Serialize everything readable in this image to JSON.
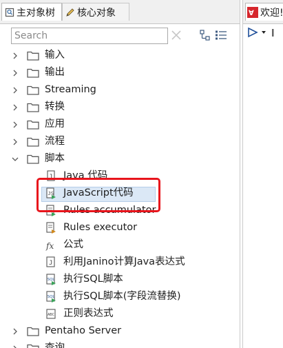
{
  "left_tabs": {
    "main_tree": "主对象树",
    "core_objects": "核心对象"
  },
  "search": {
    "placeholder": "Search",
    "value": ""
  },
  "tree": {
    "categories": [
      {
        "label": "输入",
        "expanded": false
      },
      {
        "label": "输出",
        "expanded": false
      },
      {
        "label": "Streaming",
        "expanded": false
      },
      {
        "label": "转换",
        "expanded": false
      },
      {
        "label": "应用",
        "expanded": false
      },
      {
        "label": "流程",
        "expanded": false
      },
      {
        "label": "脚本",
        "expanded": true
      }
    ],
    "script_steps": [
      {
        "label": "Java 代码",
        "icon": "java-code-icon"
      },
      {
        "label": "JavaScript代码",
        "icon": "javascript-code-icon",
        "selected": true
      },
      {
        "label": "Rules accumulator",
        "icon": "rules-accumulator-icon"
      },
      {
        "label": "Rules executor",
        "icon": "rules-executor-icon"
      },
      {
        "label": "公式",
        "icon": "formula-icon"
      },
      {
        "label": "利用Janino计算Java表达式",
        "icon": "janino-icon"
      },
      {
        "label": "执行SQL脚本",
        "icon": "sql-script-icon"
      },
      {
        "label": "执行SQL脚本(字段流替换)",
        "icon": "sql-script-stream-icon"
      },
      {
        "label": "正则表达式",
        "icon": "regex-icon"
      }
    ],
    "after": [
      {
        "label": "Pentaho Server",
        "expanded": false
      },
      {
        "label": "查询",
        "expanded": false
      }
    ]
  },
  "right_tabs": {
    "welcome": "欢迎!"
  },
  "colors": {
    "highlight": "#e8141c",
    "selection": "#dbe8f6",
    "folder": "#5a5a5a"
  }
}
